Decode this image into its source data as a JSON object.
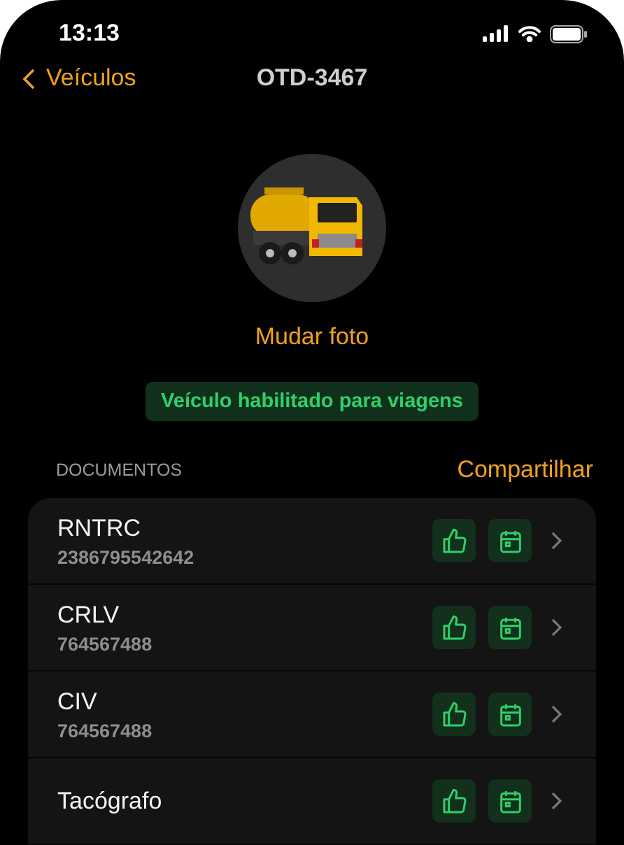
{
  "status_bar": {
    "time": "13:13"
  },
  "nav": {
    "back_label": "Veículos",
    "title": "OTD-3467"
  },
  "vehicle": {
    "change_photo": "Mudar foto",
    "status_badge": "Veículo habilitado para viagens"
  },
  "documents": {
    "heading": "DOCUMENTOS",
    "share": "Compartilhar",
    "items": [
      {
        "name": "RNTRC",
        "number": "2386795542642"
      },
      {
        "name": "CRLV",
        "number": "764567488"
      },
      {
        "name": "CIV",
        "number": "764567488"
      },
      {
        "name": "Tacógrafo"
      }
    ]
  }
}
